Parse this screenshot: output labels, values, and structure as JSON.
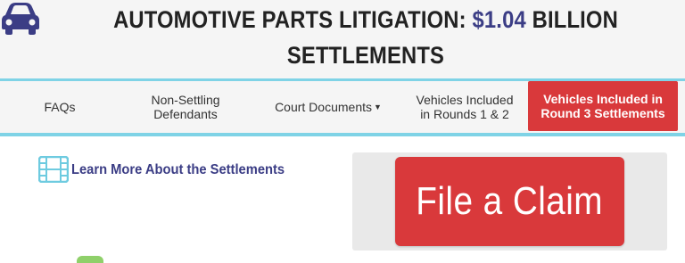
{
  "header": {
    "title_prefix": "AUTOMOTIVE PARTS LITIGATION: ",
    "title_amount": "$1.04",
    "title_suffix": " BILLION SETTLEMENTS",
    "logo_icon": "car-icon",
    "logo_color": "#3b3d85",
    "amount_color": "#3b3d85"
  },
  "nav": {
    "items": [
      {
        "label": "FAQs"
      },
      {
        "label": "Non-Settling Defendants"
      },
      {
        "label": "Court Documents",
        "has_dropdown": true
      },
      {
        "label": "Vehicles Included in Rounds 1 & 2"
      },
      {
        "label": "Vehicles Included in Round 3 Settlements",
        "active": true
      }
    ],
    "border_color": "#7fd3e6",
    "active_color": "#d9393b"
  },
  "learn_more": {
    "label": "Learn More About the Settlements",
    "icon": "film-icon"
  },
  "claim": {
    "label": "File a Claim",
    "button_color": "#d9393b"
  }
}
